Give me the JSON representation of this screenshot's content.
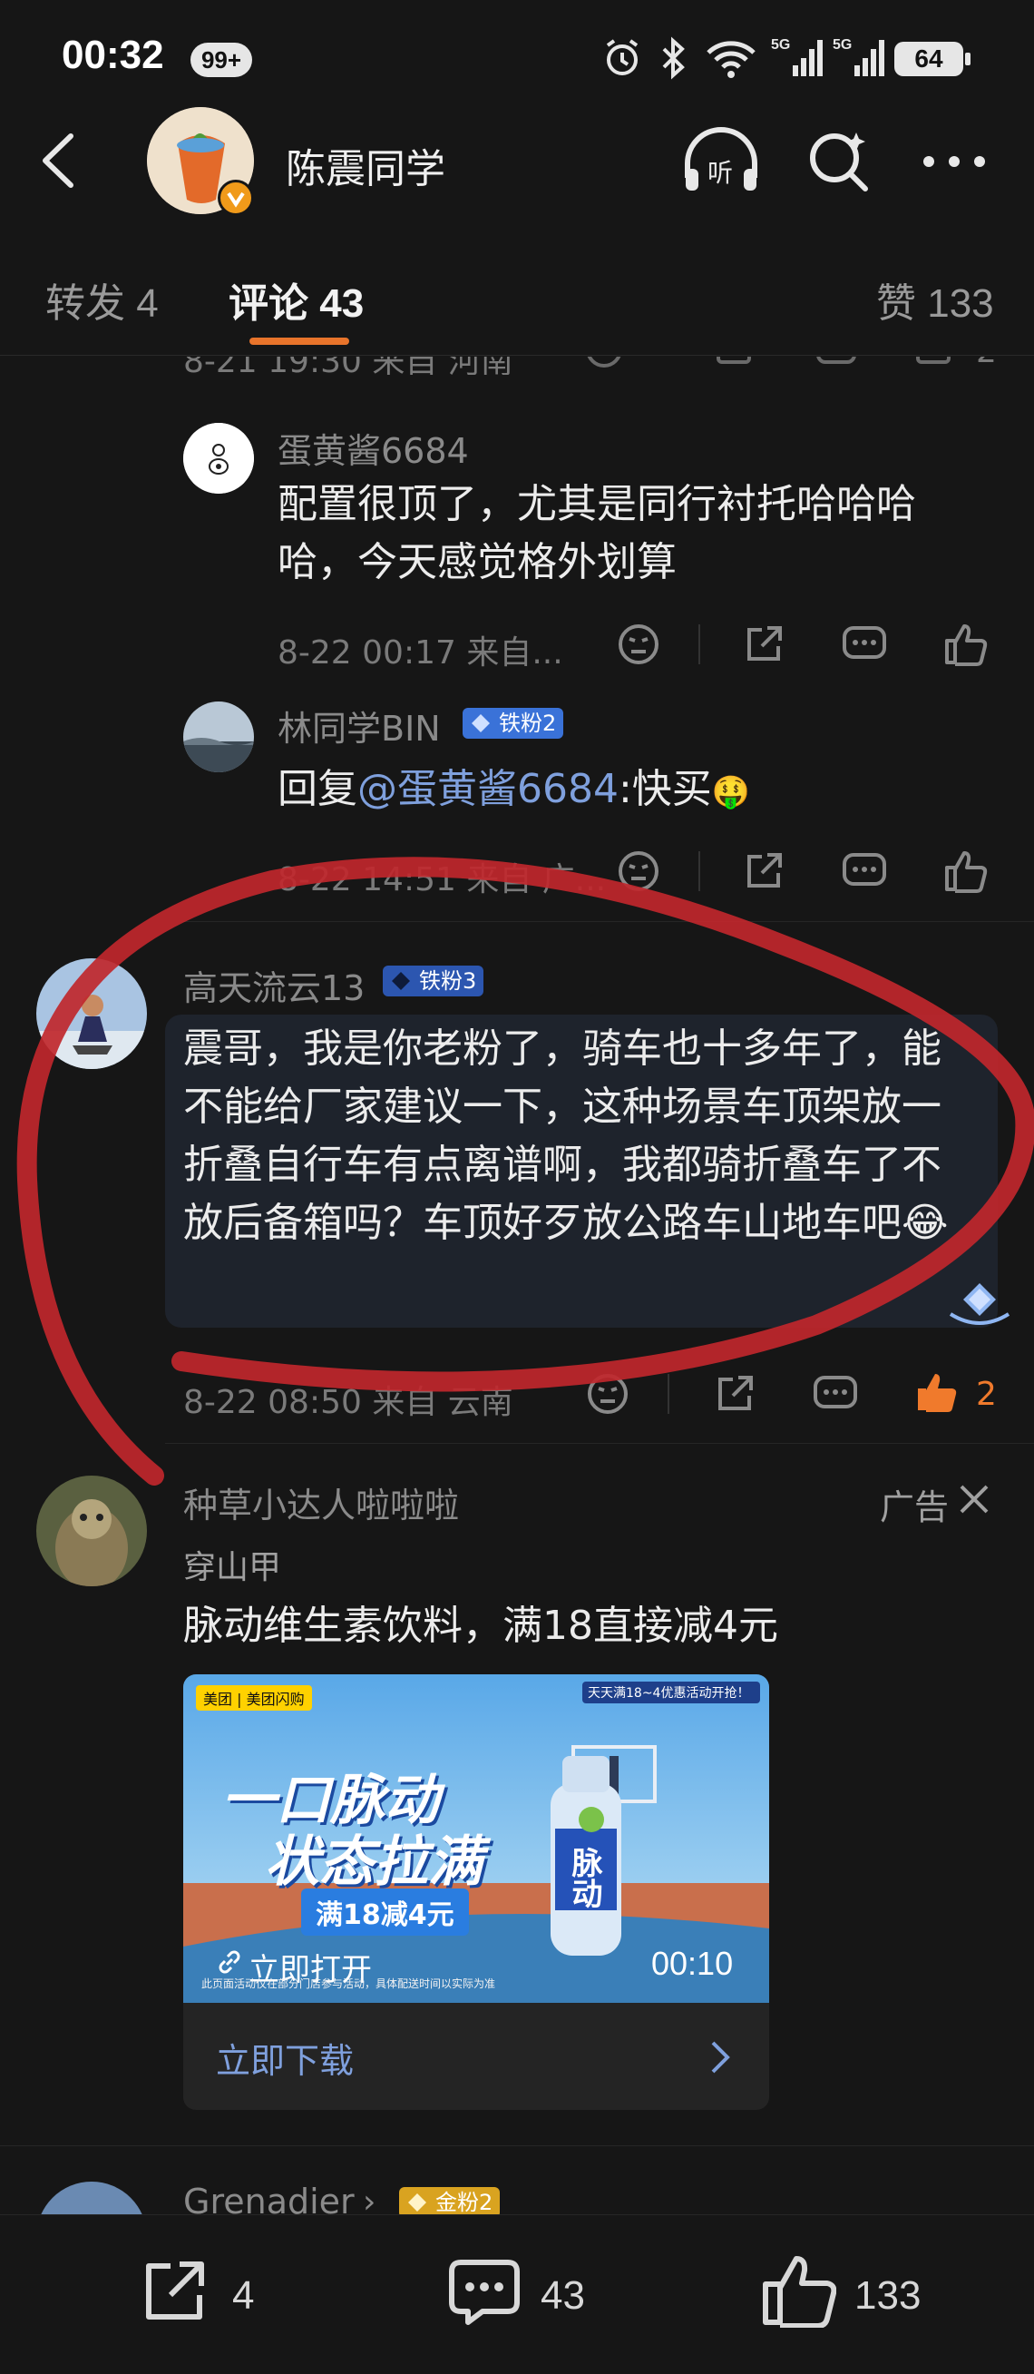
{
  "status": {
    "time": "00:32",
    "badge": "99+",
    "battery": "64",
    "net1": "5G",
    "net2": "5G"
  },
  "header": {
    "title": "陈震同学"
  },
  "tabs": {
    "repost": "转发 4",
    "comments": "评论 43",
    "likes": "赞 133"
  },
  "partial_top_meta": "8-21 19:30 来自 河南",
  "partial_top_like_count": "2",
  "replies": [
    {
      "name": "蛋黄酱6684",
      "text": "配置很顶了，尤其是同行衬托哈哈哈哈，今天感觉格外划算",
      "meta": "8-22 00:17 来自..."
    },
    {
      "name": "林同学BIN",
      "badge": "铁粉2",
      "reply_prefix": "回复",
      "mention": "@蛋黄酱6684",
      "text_after": ":快买",
      "emoji": "🤑",
      "meta": "8-22 14:51 来自 广..."
    }
  ],
  "main_comment": {
    "name": "高天流云13",
    "badge": "铁粉3",
    "text": "震哥，我是你老粉了，骑车也十多年了，能不能给厂家建议一下，这种场景车顶架放一折叠自行车有点离谱啊，我都骑折叠车了不放后备箱吗？车顶好歹放公路车山地车吧😂",
    "meta": "8-22 08:50 来自 云南",
    "like_count": "2"
  },
  "ad": {
    "name": "种草小达人啦啦啦",
    "label": "广告",
    "subname": "穿山甲",
    "text": "脉动维生素饮料，满18直接减4元",
    "image": {
      "headline1": "一口脉动",
      "headline2": "状态拉满",
      "promo": "满18减4元",
      "open_label": "立即打开",
      "duration": "00:10",
      "brand": "脉动",
      "logos": "美团 | 美团闪购",
      "fine_print": "此页面活动仅在部分门店参与活动，具体配送时间以实际为准",
      "top_right_text": "天天满18~4优惠活动开抢！"
    },
    "download_label": "立即下载"
  },
  "next_comment": {
    "name": "Grenadier",
    "badge": "金粉2"
  },
  "bottom_bar": {
    "reposts": "4",
    "comments": "43",
    "likes": "133"
  },
  "colors": {
    "background": "#161616",
    "accent": "#e8742b",
    "link": "#7fa0dd",
    "marker": "#c0272d"
  }
}
